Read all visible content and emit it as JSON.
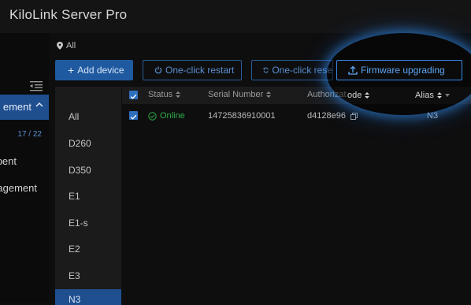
{
  "app": {
    "title": "KiloLink Server Pro"
  },
  "sidebar": {
    "active_label": "ement",
    "count": "17 / 22",
    "items": [
      {
        "label": "pent"
      },
      {
        "label": "agement"
      }
    ]
  },
  "breadcrumb": {
    "text": "All"
  },
  "toolbar": {
    "add": "Add device",
    "add_icon": "+",
    "restart": "One-click restart",
    "reset": "One-click rese",
    "firmware": "Firmware upgrading"
  },
  "filters": [
    "All",
    "D260",
    "D350",
    "E1",
    "E1-s",
    "E2",
    "E3",
    "N3"
  ],
  "table": {
    "headers": [
      "Status",
      "Serial Number",
      "Authorizat",
      "ode",
      "Alias"
    ],
    "rows": [
      {
        "status": "Online",
        "serial": "14725836910001",
        "auth": "d4128e96",
        "alias": "N3"
      }
    ]
  },
  "colors": {
    "accent": "#1f5aa0",
    "online": "#2fae47",
    "highlight": "#3a8be8"
  },
  "icons": [
    "menu-collapse-icon",
    "chevron-up-icon",
    "location-pin-icon",
    "power-icon",
    "refresh-icon",
    "upload-icon",
    "sort-icon",
    "check-circle-icon",
    "copy-icon"
  ]
}
